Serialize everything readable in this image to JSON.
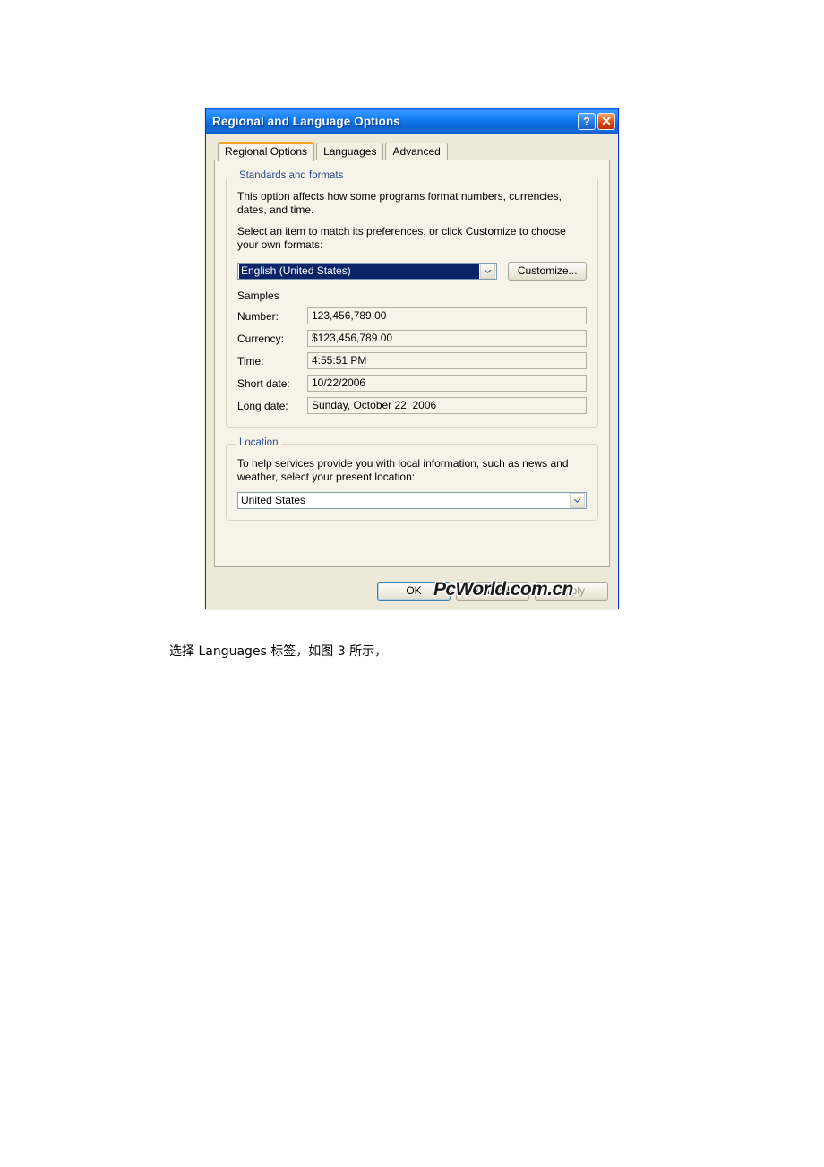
{
  "document": {
    "caption": "选择 Languages 标签，如图 3 所示，",
    "watermark": "PcWorld.com.cn"
  },
  "dialog": {
    "title": "Regional and Language Options",
    "titlebar_buttons": [
      {
        "name": "help-button",
        "glyph": "?"
      },
      {
        "name": "close-button",
        "glyph": "✕"
      }
    ],
    "tabs": [
      {
        "label": "Regional Options",
        "active": true
      },
      {
        "label": "Languages",
        "active": false
      },
      {
        "label": "Advanced",
        "active": false
      }
    ],
    "standards_group": {
      "legend": "Standards and formats",
      "description_1": "This option affects how some programs format numbers, currencies, dates, and time.",
      "description_2": "Select an item to match its preferences, or click Customize to choose your own formats:",
      "locale_value": "English (United States)",
      "customize_button": "Customize...",
      "samples_title": "Samples",
      "samples": [
        {
          "label": "Number:",
          "value": "123,456,789.00"
        },
        {
          "label": "Currency:",
          "value": "$123,456,789.00"
        },
        {
          "label": "Time:",
          "value": "4:55:51 PM"
        },
        {
          "label": "Short date:",
          "value": "10/22/2006"
        },
        {
          "label": "Long date:",
          "value": "Sunday, October 22, 2006"
        }
      ]
    },
    "location_group": {
      "legend": "Location",
      "description": "To help services provide you with local information, such as news and weather, select your present location:",
      "location_value": "United States"
    },
    "footer_buttons": [
      {
        "label": "OK",
        "state": "default"
      },
      {
        "label": "Cancel",
        "state": "normal"
      },
      {
        "label": "Apply",
        "state": "disabled"
      }
    ]
  },
  "colors": {
    "titlebar_blue": "#0058ee",
    "dialog_face": "#ece9d8",
    "tab_active_accent": "#f0a524",
    "legend_text": "#2b4b8f",
    "selection_blue": "#0a246a",
    "close_button_red": "#d53a0d"
  }
}
